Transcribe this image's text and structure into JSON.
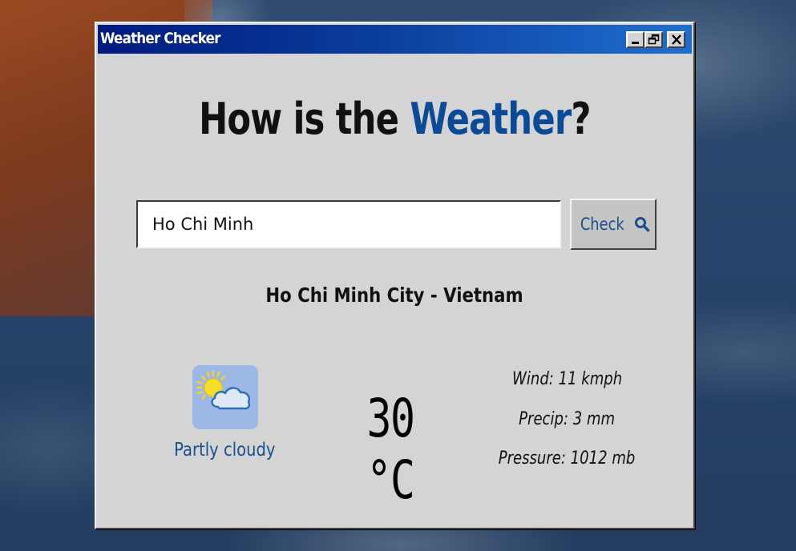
{
  "window": {
    "title": "Weather Checker",
    "controls": [
      "minimize-icon",
      "restore-icon",
      "close-icon"
    ]
  },
  "heading": {
    "prefix": "How is the ",
    "accent": "Weather",
    "suffix": "?",
    "accent_color": "#0a4a96"
  },
  "search": {
    "value": "Ho Chi Minh",
    "button_label": "Check",
    "button_icon": "search-icon"
  },
  "result": {
    "location": "Ho Chi Minh City - Vietnam",
    "condition_icon": "partly-cloudy-icon",
    "condition": "Partly cloudy",
    "temperature": "30 °C",
    "wind": "Wind: 11 kmph",
    "precip": "Precip: 3 mm",
    "pressure": "Pressure: 1012 mb"
  },
  "colors": {
    "titlebar_start": "#001a80",
    "titlebar_end": "#1f6fd0",
    "window_bg": "#d4d4d4",
    "link_blue": "#1b4f8c",
    "icon_bg": "#9db8e6"
  }
}
